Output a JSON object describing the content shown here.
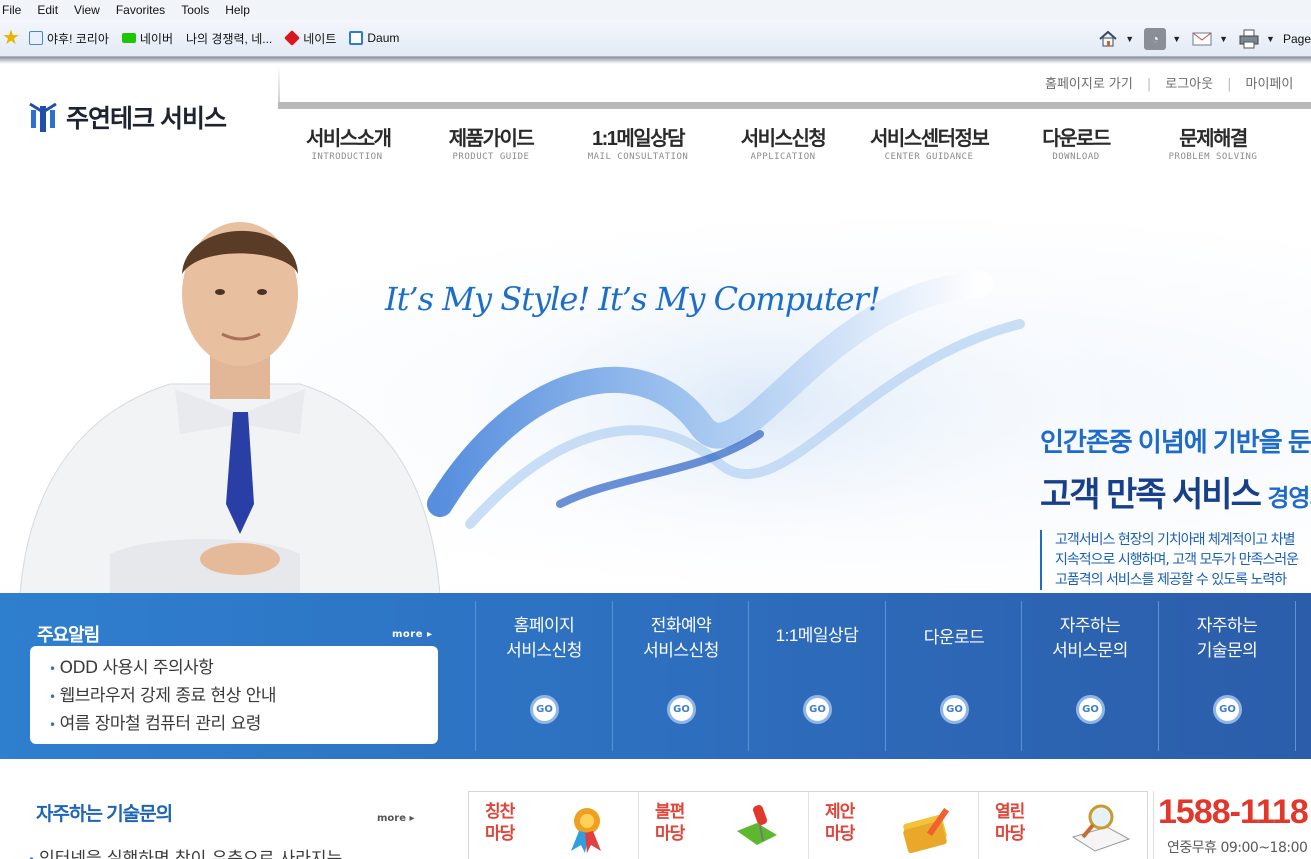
{
  "browser": {
    "menu": [
      "File",
      "Edit",
      "View",
      "Favorites",
      "Tools",
      "Help"
    ],
    "favorites": [
      {
        "label": "야후! 코리아",
        "icon": "ie-page-icon"
      },
      {
        "label": "네이버",
        "icon": "naver-icon"
      },
      {
        "label": "나의 경쟁력, 네...",
        "icon": "none"
      },
      {
        "label": "네이트",
        "icon": "nate-icon"
      },
      {
        "label": "Daum",
        "icon": "daum-icon"
      }
    ],
    "toolbar_page_label": "Page"
  },
  "site": {
    "logo_text": "주연테크 서비스",
    "util_links": [
      "홈페이지로 가기",
      "로그아웃",
      "마이페이"
    ],
    "nav": [
      {
        "kr": "서비스소개",
        "en": "INTRODUCTION"
      },
      {
        "kr": "제품가이드",
        "en": "PRODUCT GUIDE"
      },
      {
        "kr": "1:1메일상담",
        "en": "MAIL CONSULTATION"
      },
      {
        "kr": "서비스신청",
        "en": "APPLICATION"
      },
      {
        "kr": "서비스센터정보",
        "en": "CENTER GUIDANCE"
      },
      {
        "kr": "다운로드",
        "en": "DOWNLOAD"
      },
      {
        "kr": "문제해결",
        "en": "PROBLEM SOLVING"
      }
    ],
    "hero": {
      "slogan": "It’s My Style!  It’s My Computer!",
      "line1": "인간존중 이념에 기반을 둔",
      "line2_big": "고객 만족 서비스",
      "line2_small": "경영의",
      "desc": [
        "고객서비스 현장의 기치아래 체계적이고 차별",
        "지속적으로 시행하며, 고객 모두가 만족스러운",
        "고품격의 서비스를 제공할 수 있도록 노력하"
      ]
    },
    "notice": {
      "title": "주요알림",
      "more": "more",
      "items": [
        "ODD 사용시 주의사항",
        "웹브라우저 강제 종료 현상 안내",
        "여름 장마철 컴퓨터 관리 요령"
      ]
    },
    "quick": [
      {
        "label": "홈페이지\n서비스신청",
        "go": "GO"
      },
      {
        "label": "전화예약\n서비스신청",
        "go": "GO"
      },
      {
        "label": "1:1메일상담",
        "go": "GO"
      },
      {
        "label": "다운로드",
        "go": "GO"
      },
      {
        "label": "자주하는\n서비스문의",
        "go": "GO"
      },
      {
        "label": "자주하는\n기술문의",
        "go": "GO"
      }
    ],
    "faq": {
      "title": "자주하는 기술문의",
      "more": "more",
      "items": [
        "인터넷을 실행하면 창이 우측으로 사라지는 ..."
      ]
    },
    "madang": [
      {
        "label": "칭찬\n마당",
        "icon": "ribbon-icon"
      },
      {
        "label": "불편\n마당",
        "icon": "pushpin-icon"
      },
      {
        "label": "제안\n마당",
        "icon": "memo-pencil-icon"
      },
      {
        "label": "열린\n마당",
        "icon": "magnifier-icon"
      }
    ],
    "callcenter": {
      "phone": "1588-1118",
      "hours": "연중무휴 09:00~18:00"
    }
  },
  "colors": {
    "brand_blue": "#2e6fbf",
    "accent_red": "#e3372b",
    "slogan_blue": "#1d6ec8"
  }
}
